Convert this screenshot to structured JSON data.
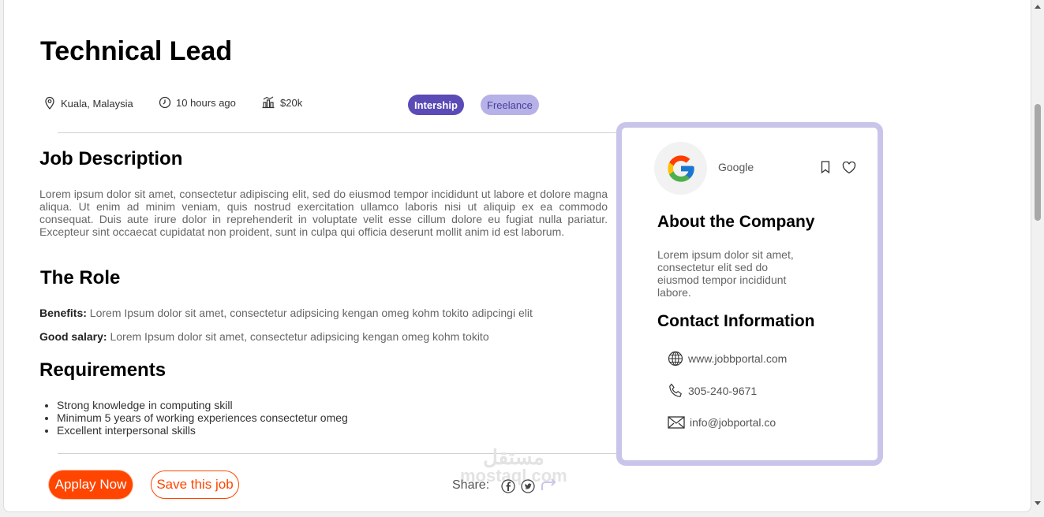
{
  "job": {
    "title": "Technical Lead",
    "location": "Kuala, Malaysia",
    "posted": "10 hours ago",
    "salary": "$20k",
    "tags": [
      "Intership",
      "Freelance"
    ]
  },
  "description": {
    "heading": "Job Description",
    "text": "Lorem ipsum dolor sit amet, consectetur adipiscing elit, sed do eiusmod tempor incididunt ut labore et dolore magna aliqua. Ut enim ad minim veniam, quis nostrud exercitation ullamco laboris nisi ut aliquip ex ea commodo consequat. Duis aute irure dolor in reprehenderit in voluptate velit esse cillum dolore eu fugiat nulla pariatur. Excepteur sint occaecat cupidatat non proident, sunt in culpa qui officia deserunt mollit anim id est laborum."
  },
  "role": {
    "heading": "The Role",
    "benefits_label": "Benefits:",
    "benefits_text": " Lorem Ipsum dolor sit amet, consectetur adipsicing kengan omeg kohm tokito adipcingi elit",
    "salary_label": "Good salary:",
    "salary_text": " Lorem Ipsum dolor sit amet, consectetur adipsicing kengan omeg kohm tokito"
  },
  "requirements": {
    "heading": "Requirements",
    "items": [
      "Strong knowledge in computing skill",
      "Minimum 5 years of working experiences consectetur omeg",
      "Excellent interpersonal skills"
    ]
  },
  "actions": {
    "apply_label": "Applay Now",
    "save_label": "Save this job",
    "share_label": "Share:"
  },
  "watermark": {
    "arabic": "مستقل",
    "latin": "mostaql.com"
  },
  "company": {
    "name": "Google",
    "about_heading": "About the Company",
    "about_text": "Lorem ipsum dolor sit amet, consectetur elit sed do eiusmod tempor incididunt labore.",
    "contact_heading": "Contact Information",
    "website": "www.jobbportal.com",
    "phone": "305-240-9671",
    "email": "info@jobportal.co"
  },
  "colors": {
    "accent": "#ff4500",
    "tag_primary": "#5a4bb6",
    "tag_secondary": "#b6b1e6",
    "card_border": "#c9c5ea"
  }
}
